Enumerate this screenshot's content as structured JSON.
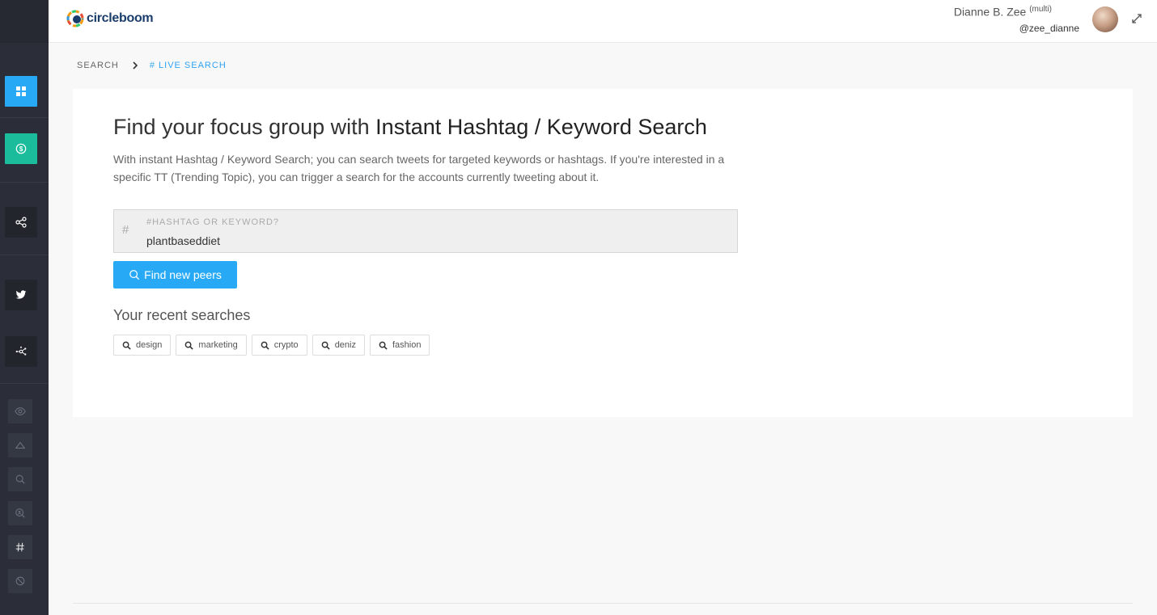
{
  "brand": {
    "logo_text": "circleboom"
  },
  "user": {
    "name": "Dianne B. Zee",
    "badge": "(multi)",
    "handle": "@zee_dianne"
  },
  "breadcrumb": {
    "parent": "SEARCH",
    "current": "# LIVE SEARCH"
  },
  "main": {
    "title_light": "Find your focus group with ",
    "title_bold": "Instant Hashtag / Keyword Search",
    "description": "With instant Hashtag / Keyword Search; you can search tweets for targeted keywords or hashtags. If you're interested in a specific TT (Trending Topic), you can trigger a search for the accounts currently tweeting about it.",
    "search": {
      "prefix": "#",
      "label": "#HASHTAG OR KEYWORD?",
      "value": "plantbaseddiet"
    },
    "find_button": "Find new peers",
    "recent_title": "Your recent searches",
    "recent": [
      "design",
      "marketing",
      "crypto",
      "deniz",
      "fashion"
    ]
  },
  "sidebar": {
    "items": [
      {
        "name": "dashboard",
        "icon": "grid-icon",
        "color": "#27a9f5"
      },
      {
        "name": "pricing",
        "icon": "dollar-icon",
        "color": "#1abc9c"
      },
      {
        "name": "share",
        "icon": "share-icon",
        "color": "#22252c"
      },
      {
        "name": "twitter",
        "icon": "twitter-icon",
        "color": "#22252c"
      },
      {
        "name": "network",
        "icon": "network-icon",
        "color": "#22252c"
      },
      {
        "name": "watch",
        "icon": "eye-icon"
      },
      {
        "name": "home",
        "icon": "home-icon"
      },
      {
        "name": "search",
        "icon": "search-icon"
      },
      {
        "name": "search-users",
        "icon": "zoom-user-icon"
      },
      {
        "name": "hashtag",
        "icon": "hashtag-icon"
      },
      {
        "name": "block",
        "icon": "block-icon"
      }
    ]
  },
  "colors": {
    "accent": "#27a9f5",
    "teal": "#1abc9c",
    "sidebar": "#2b2e38"
  }
}
